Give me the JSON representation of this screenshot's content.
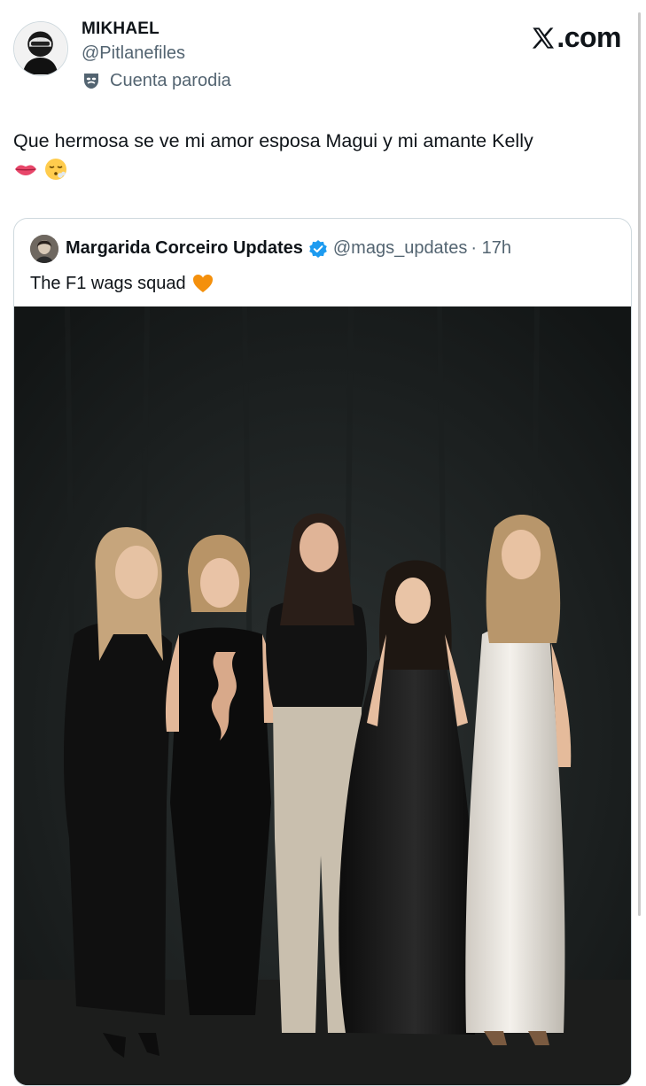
{
  "author": {
    "display_name": "MIKHAEL",
    "handle": "@Pitlanefiles",
    "label": "Cuenta parodia",
    "avatar_icon": "helmet-avatar-icon",
    "label_icon": "theater-mask-icon"
  },
  "brand": {
    "logo_text": ".com",
    "logo_icon": "x-logo-icon"
  },
  "tweet": {
    "text": "Que hermosa se ve mi amor esposa Magui y mi amante Kelly",
    "emojis": [
      "lips-emoji-icon",
      "face-exhaling-emoji-icon"
    ]
  },
  "quoted_tweet": {
    "display_name": "Margarida Corceiro Updates",
    "handle": "@mags_updates",
    "time": "· 17h",
    "text": "The F1 wags squad",
    "text_emoji": "orange-heart-icon",
    "verified_icon": "verified-badge-icon",
    "media": "photo"
  },
  "colors": {
    "text_primary": "#0f1419",
    "text_secondary": "#536471",
    "verified_blue": "#1d9bf0",
    "border": "#cfd9de"
  }
}
